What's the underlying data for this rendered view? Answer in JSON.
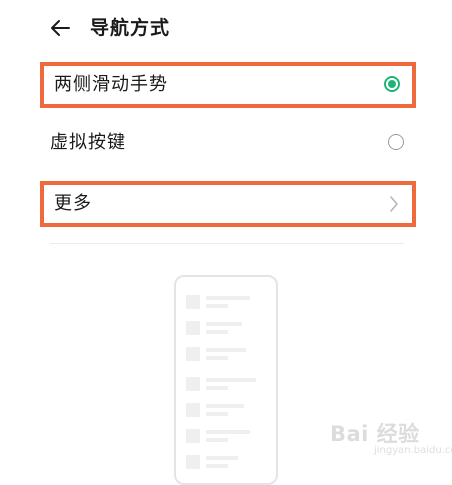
{
  "header": {
    "title": "导航方式",
    "back_icon": "arrow-left-icon"
  },
  "options": [
    {
      "label": "两侧滑动手势",
      "control": "radio",
      "selected": true,
      "highlighted": true
    },
    {
      "label": "虚拟按键",
      "control": "radio",
      "selected": false,
      "highlighted": false
    },
    {
      "label": "更多",
      "control": "chevron",
      "highlighted": true
    }
  ],
  "colors": {
    "accent_green": "#1fb37a",
    "highlight_orange": "#ee6a3c"
  },
  "watermark": {
    "text": "Bai 经验",
    "sub": "jingyan.baidu.com"
  }
}
